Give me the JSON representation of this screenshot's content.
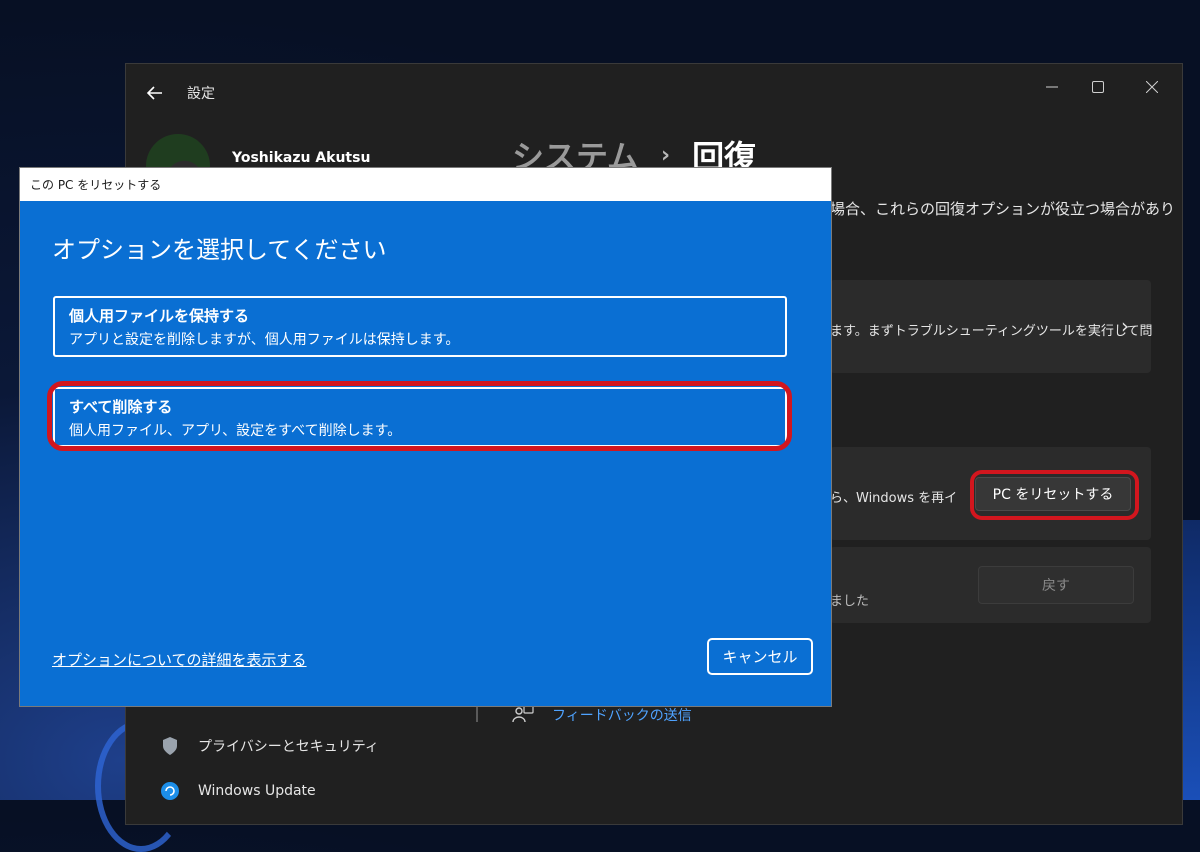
{
  "settings": {
    "title": "設定",
    "profile_name": "Yoshikazu Akutsu",
    "breadcrumb_parent": "システム",
    "breadcrumb_sep": "›",
    "breadcrumb_current": "回復",
    "description": "場合、これらの回復オプションが役立つ場合があり",
    "fix_card_text": "ます。まずトラブルシューティングツールを実行して問",
    "reset_card_text": "ら、Windows を再イ",
    "reset_button": "PC をリセットする",
    "goback_card_text": "ました",
    "goback_button": "戻す",
    "feedback": "フィードバックの送信",
    "nav": [
      {
        "label": "プライバシーとセキュリティ",
        "icon": "shield-icon"
      },
      {
        "label": "Windows Update",
        "icon": "windows-update-icon"
      }
    ]
  },
  "dialog": {
    "title": "この PC をリセットする",
    "heading": "オプションを選択してください",
    "options": [
      {
        "title": "個人用ファイルを保持する",
        "desc": "アプリと設定を削除しますが、個人用ファイルは保持します。"
      },
      {
        "title": "すべて削除する",
        "desc": "個人用ファイル、アプリ、設定をすべて削除します。"
      }
    ],
    "more_link": "オプションについての詳細を表示する",
    "cancel": "キャンセル"
  },
  "colors": {
    "dialog_bg": "#0a6fd3",
    "settings_bg": "#202020",
    "highlight": "#d2161e"
  }
}
